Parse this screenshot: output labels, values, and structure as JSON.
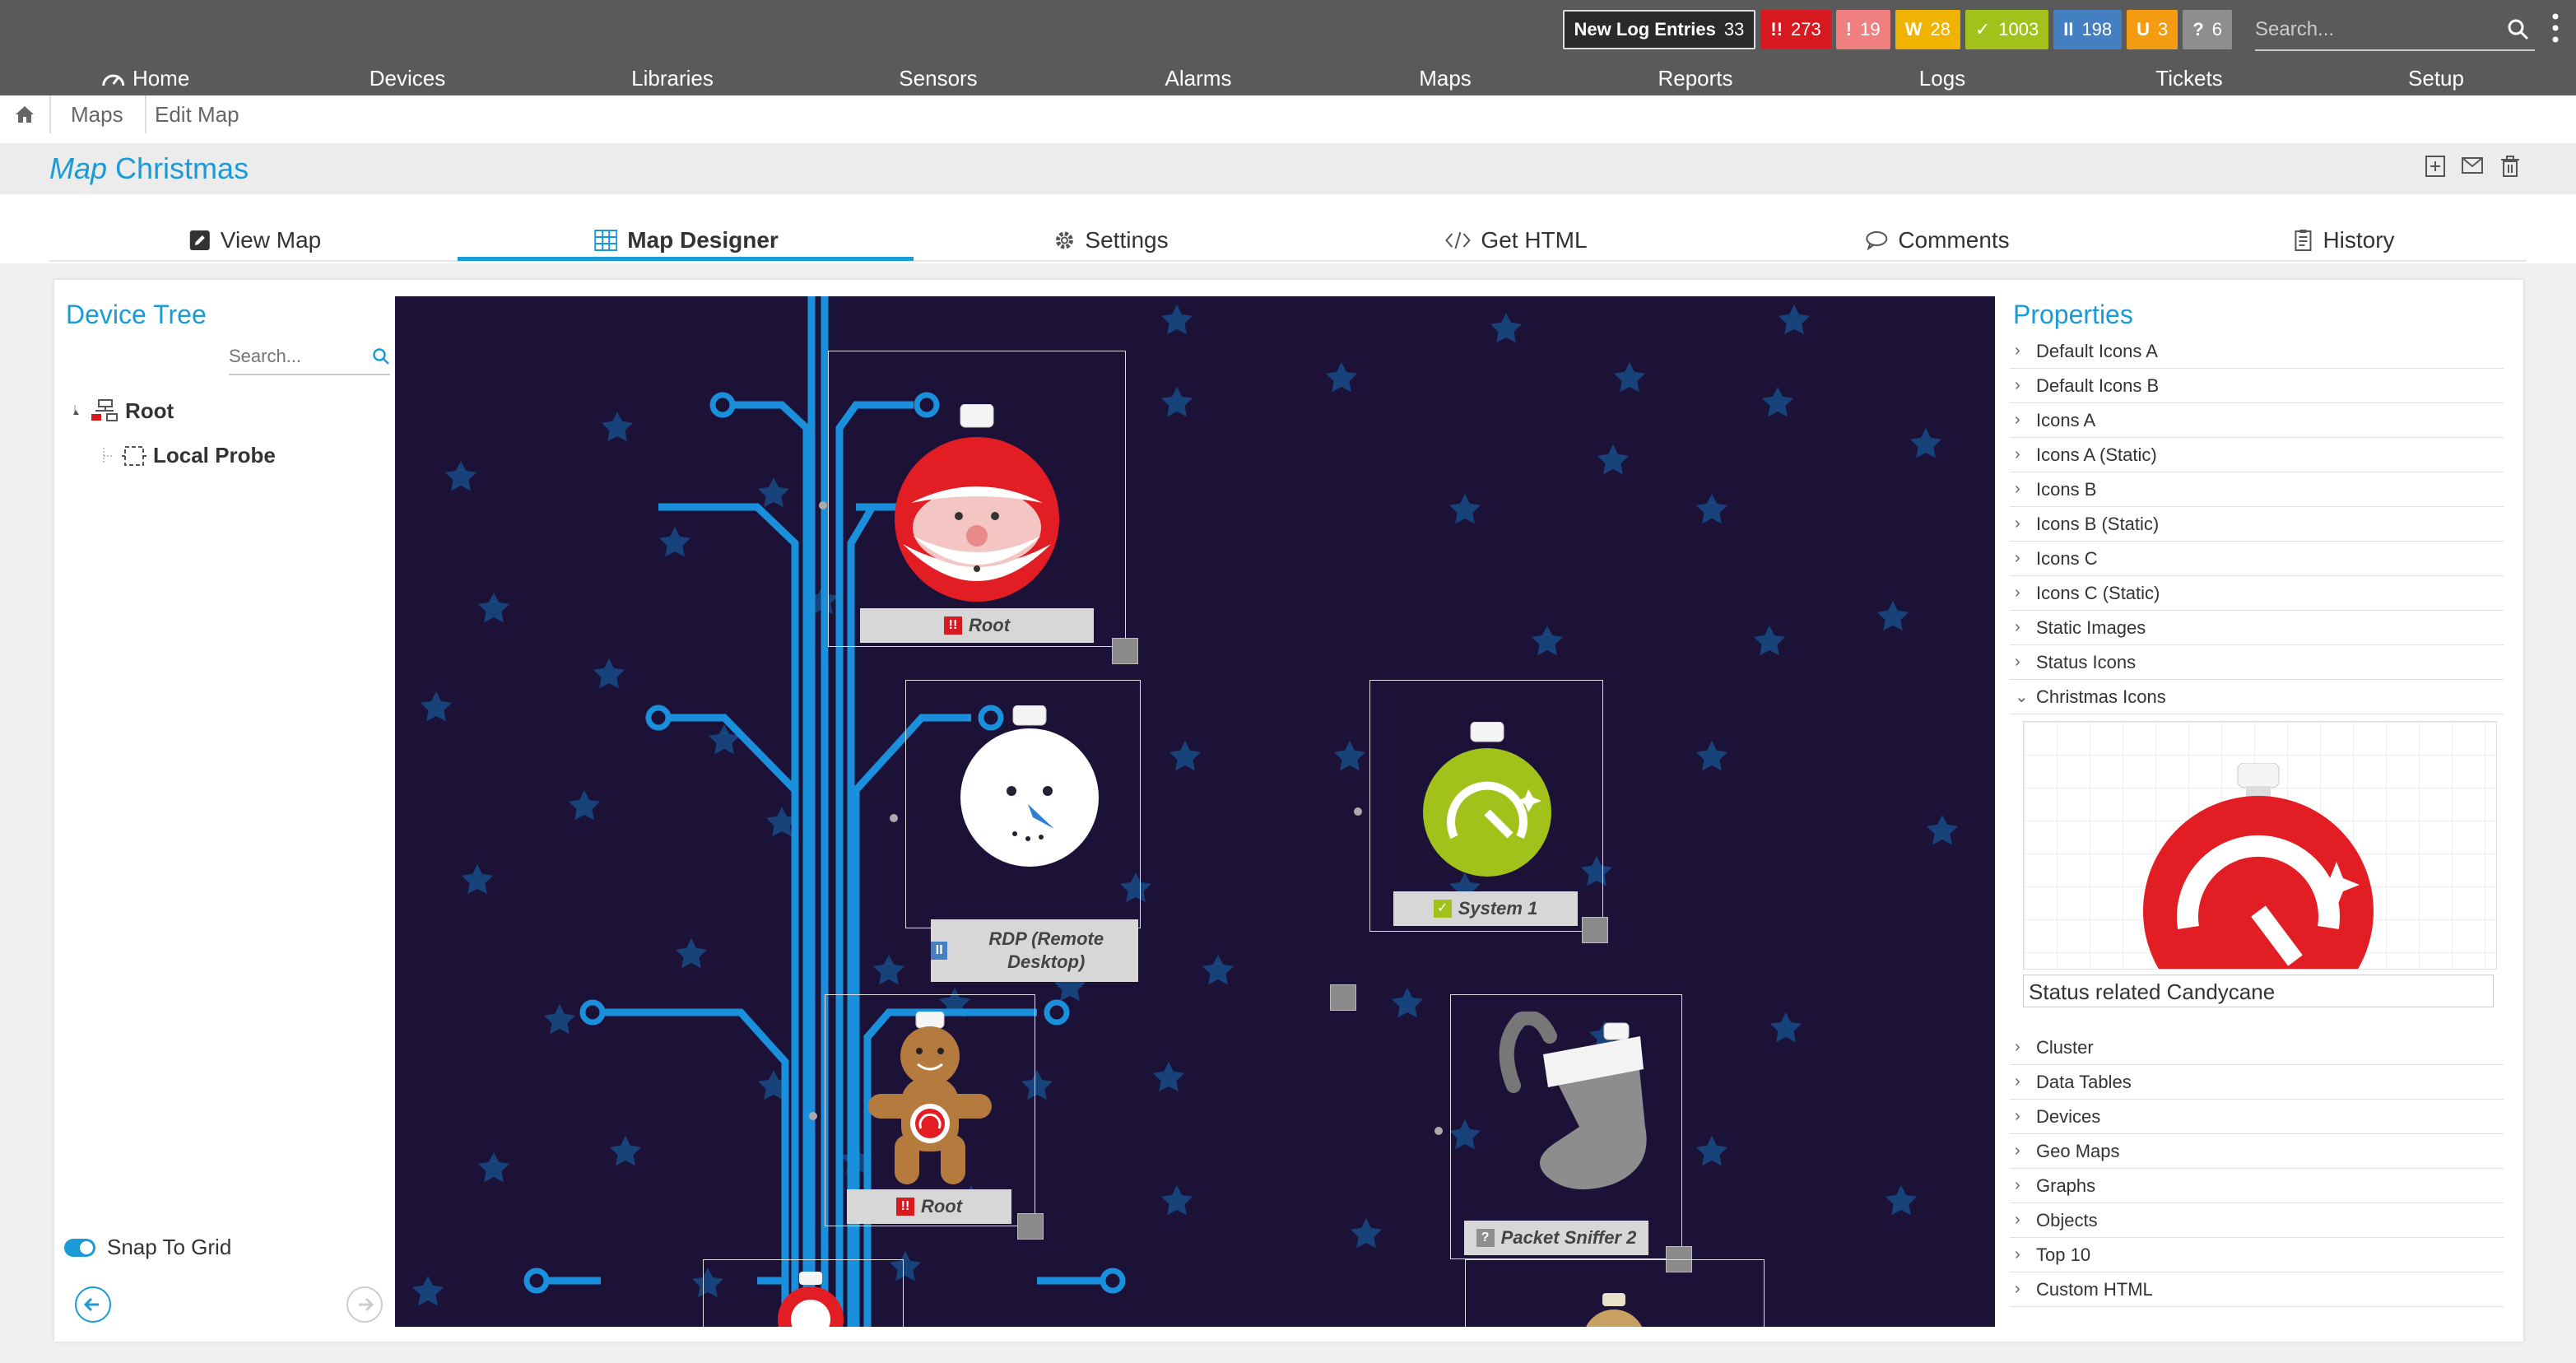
{
  "header": {
    "badges": [
      {
        "label": "New Log Entries",
        "count": "33"
      },
      {
        "label": "!!",
        "count": "273"
      },
      {
        "label": "!",
        "count": "19"
      },
      {
        "label": "W",
        "count": "28"
      },
      {
        "label": "✓",
        "count": "1003"
      },
      {
        "label": "II",
        "count": "198"
      },
      {
        "label": "U",
        "count": "3"
      },
      {
        "label": "?",
        "count": "6"
      }
    ],
    "search_placeholder": "Search...",
    "nav": [
      "Home",
      "Devices",
      "Libraries",
      "Sensors",
      "Alarms",
      "Maps",
      "Reports",
      "Logs",
      "Tickets",
      "Setup"
    ]
  },
  "breadcrumb": [
    "Maps",
    "Edit Map"
  ],
  "title": {
    "prefix": "Map",
    "name": "Christmas"
  },
  "tabs": [
    {
      "label": "View Map",
      "icon": "pencil-icon"
    },
    {
      "label": "Map Designer",
      "icon": "grid-icon",
      "active": true
    },
    {
      "label": "Settings",
      "icon": "gear-icon"
    },
    {
      "label": "Get HTML",
      "icon": "code-icon"
    },
    {
      "label": "Comments",
      "icon": "comment-icon"
    },
    {
      "label": "History",
      "icon": "history-icon"
    }
  ],
  "device_tree": {
    "title": "Device Tree",
    "search_placeholder": "Search...",
    "nodes": [
      "Root",
      "Local Probe"
    ],
    "snap_label": "Snap To Grid",
    "snap_on": true
  },
  "map_nodes": [
    {
      "label": "Root",
      "status": "down",
      "ornament": "santa"
    },
    {
      "label": "RDP (Remote Desktop)",
      "status": "paused",
      "ornament": "snowman"
    },
    {
      "label": "System 1",
      "status": "up",
      "ornament": "gauge"
    },
    {
      "label": "Root",
      "status": "down",
      "ornament": "gingerbread"
    },
    {
      "label": "Packet Sniffer 2",
      "status": "unknown",
      "ornament": "stocking"
    }
  ],
  "properties": {
    "title": "Properties",
    "groups_upper": [
      "Default Icons A",
      "Default Icons B",
      "Icons A",
      "Icons A (Static)",
      "Icons B",
      "Icons B (Static)",
      "Icons C",
      "Icons C (Static)",
      "Static Images",
      "Status Icons"
    ],
    "expanded_group": "Christmas Icons",
    "preview_label": "Status related Candycane",
    "groups_lower": [
      "Cluster",
      "Data Tables",
      "Devices",
      "Geo Maps",
      "Graphs",
      "Objects",
      "Top 10",
      "Custom HTML"
    ]
  },
  "colors": {
    "accent": "#1a9ad6",
    "map_background": "#1c1238",
    "circuit": "#1a8fdc",
    "status_down": "#d71920",
    "status_warning": "#f0b400",
    "status_up": "#a2c21b",
    "status_paused": "#447fc1",
    "status_unusual": "#f39c12",
    "status_unknown": "#8e8e8e"
  }
}
